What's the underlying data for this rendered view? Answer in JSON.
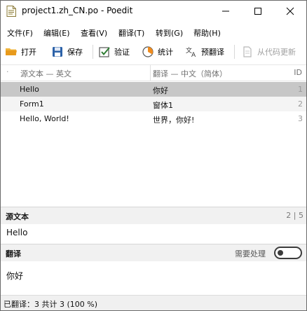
{
  "window": {
    "title": "project1.zh_CN.po - Poedit",
    "icon": "poedit-document-icon"
  },
  "menu": {
    "items": [
      {
        "label": "文件(F)"
      },
      {
        "label": "编辑(E)"
      },
      {
        "label": "查看(V)"
      },
      {
        "label": "翻译(T)"
      },
      {
        "label": "转到(G)"
      },
      {
        "label": "帮助(H)"
      }
    ]
  },
  "toolbar": {
    "open_label": "打开",
    "save_label": "保存",
    "validate_label": "验证",
    "stats_label": "统计",
    "pretranslate_label": "预翻译",
    "update_from_code_label": "从代码更新"
  },
  "list": {
    "headers": {
      "source": "源文本 — 英文",
      "translation": "翻译 — 中文（简体）",
      "id": "ID"
    },
    "rows": [
      {
        "source": "Hello",
        "translation": "你好",
        "id": "1",
        "selected": true
      },
      {
        "source": "Form1",
        "translation": "窗体1",
        "id": "2",
        "selected": false
      },
      {
        "source": "Hello, World!",
        "translation": "世界，你好!",
        "id": "3",
        "selected": false
      }
    ]
  },
  "editor": {
    "source_title": "源文本",
    "source_counter": "2 | 5",
    "source_text": "Hello",
    "translation_title": "翻译",
    "needs_work_label": "需要处理",
    "needs_work_on": false,
    "translation_text": "你好"
  },
  "status": {
    "text": "已翻译：3 共计 3 (100 %)"
  },
  "colors": {
    "selected_row": "#c7c7c7",
    "pane_header": "#f1f1f1",
    "folder_yellow": "#f0b43c",
    "save_blue": "#2c62a8",
    "validate_green": "#2e7d32",
    "stats_orange": "#f08c1e"
  }
}
